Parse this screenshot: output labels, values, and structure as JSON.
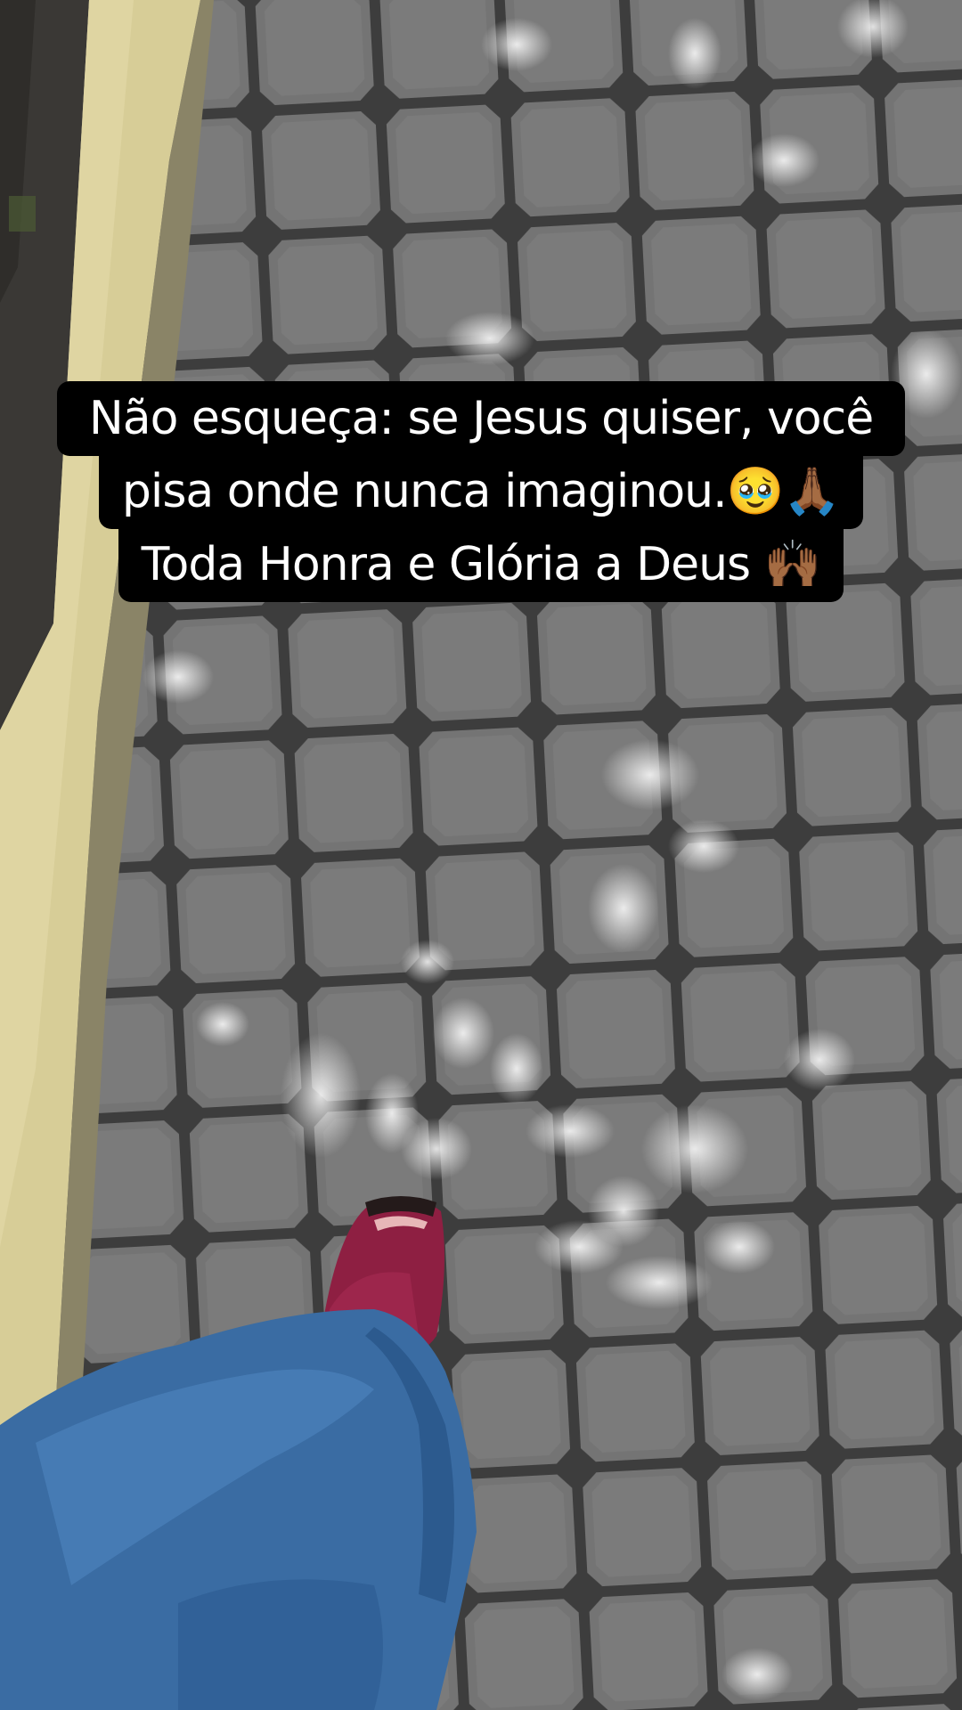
{
  "story": {
    "caption_lines": [
      "Não esqueça: se Jesus quiser, você",
      "pisa onde nunca imaginou.🥹🙏🏾",
      "Toda Honra e Glória a Deus 🙌🏾"
    ]
  },
  "scene": {
    "description_icon": "photo-background",
    "colors": {
      "pavement": "#6b6b6b",
      "pavement_dark": "#3c3c3c",
      "curb": "#d8cf98",
      "jeans": "#3b6ea5",
      "shoe": "#9a2347",
      "caption_bg": "#000000"
    }
  }
}
